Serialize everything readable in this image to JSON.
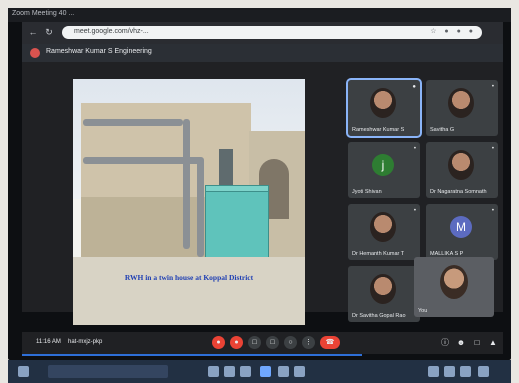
{
  "tab": {
    "title": "Zoom Meeting 40 ..."
  },
  "browser": {
    "url": "meet.google.com/vhz-..."
  },
  "meeting": {
    "title": "Rameshwar Kumar S Engineering",
    "time": "11:16 AM",
    "code": "hat-mxjz-pkp"
  },
  "slide": {
    "caption": "RWH in a twin house at Koppal District"
  },
  "participants": [
    {
      "name": "Rameshwar Kumar S",
      "kind": "photo",
      "active": true
    },
    {
      "name": "Savitha G",
      "kind": "photo",
      "active": false
    },
    {
      "name": "Jyoti Shivan",
      "kind": "letter",
      "letter": "j",
      "color": "#2e7d32",
      "active": false
    },
    {
      "name": "Dr Nagaratna Somnath",
      "kind": "photo",
      "active": false
    },
    {
      "name": "Dr Hemanth Kumar T",
      "kind": "photo",
      "active": false
    },
    {
      "name": "MALLIKA S P",
      "kind": "letter",
      "letter": "M",
      "color": "#5c6bc0",
      "active": false
    },
    {
      "name": "Dr Savitha Gopal Rao",
      "kind": "photo",
      "active": false
    }
  ],
  "self": {
    "name": "You"
  },
  "colors": {
    "accent": "#8ab4f8",
    "end_call": "#ea4335"
  }
}
